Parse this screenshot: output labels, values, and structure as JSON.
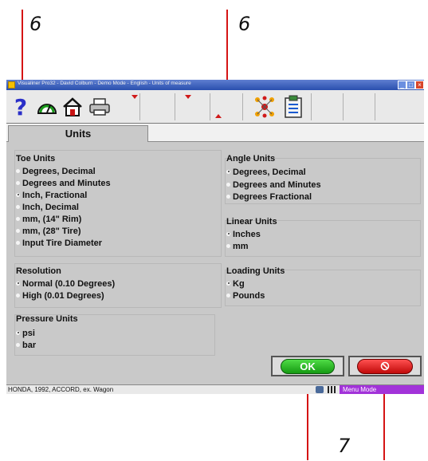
{
  "callouts": {
    "label_a": "6",
    "label_b": "6",
    "label_c": "7"
  },
  "window": {
    "title": "Visualiner Pro32 - David Colburn - Demo Mode - English - Units of measure",
    "controls": [
      "minimize-icon",
      "maximize-icon",
      "close-icon"
    ]
  },
  "toolbar": {
    "icons": [
      "help-icon",
      "gauge-icon",
      "home-icon",
      "printer-icon",
      "network-icon",
      "clipboard-icon"
    ],
    "help_glyph": "?"
  },
  "tabs": {
    "units": "Units"
  },
  "toe_units": {
    "title": "Toe Units",
    "options": [
      "Degrees, Decimal",
      "Degrees and Minutes",
      "Inch, Fractional",
      "Inch, Decimal",
      "mm, (14\" Rim)",
      "mm, (28\" Tire)",
      "Input Tire Diameter"
    ],
    "selected": "Inch, Fractional"
  },
  "resolution": {
    "title": "Resolution",
    "options": [
      "Normal (0.10 Degrees)",
      "High (0.01 Degrees)"
    ],
    "selected": "Normal (0.10 Degrees)"
  },
  "pressure_units": {
    "title": "Pressure Units",
    "options": [
      "psi",
      "bar"
    ],
    "selected": "psi"
  },
  "angle_units": {
    "title": "Angle Units",
    "options": [
      "Degrees, Decimal",
      "Degrees and Minutes",
      "Degrees Fractional"
    ],
    "selected": "Degrees, Decimal"
  },
  "linear_units": {
    "title": "Linear Units",
    "options": [
      "Inches",
      "mm"
    ],
    "selected": "Inches"
  },
  "loading_units": {
    "title": "Loading Units",
    "options": [
      "Kg",
      "Pounds"
    ],
    "selected": "Kg"
  },
  "buttons": {
    "ok_label": "OK",
    "cancel_icon": "no-entry-icon"
  },
  "status": {
    "vehicle": "HONDA, 1992, ACCORD, ex. Wagon",
    "mode": "Menu Mode",
    "icons": [
      "operator-icon",
      "grid-icon"
    ]
  },
  "colors": {
    "callout_line": "#d51414",
    "titlebar": "#3a5fbe",
    "panel": "#c9c9c9",
    "ok_green": "#1fb31a",
    "cancel_red": "#e01414",
    "mode_purple": "#a233d9"
  }
}
